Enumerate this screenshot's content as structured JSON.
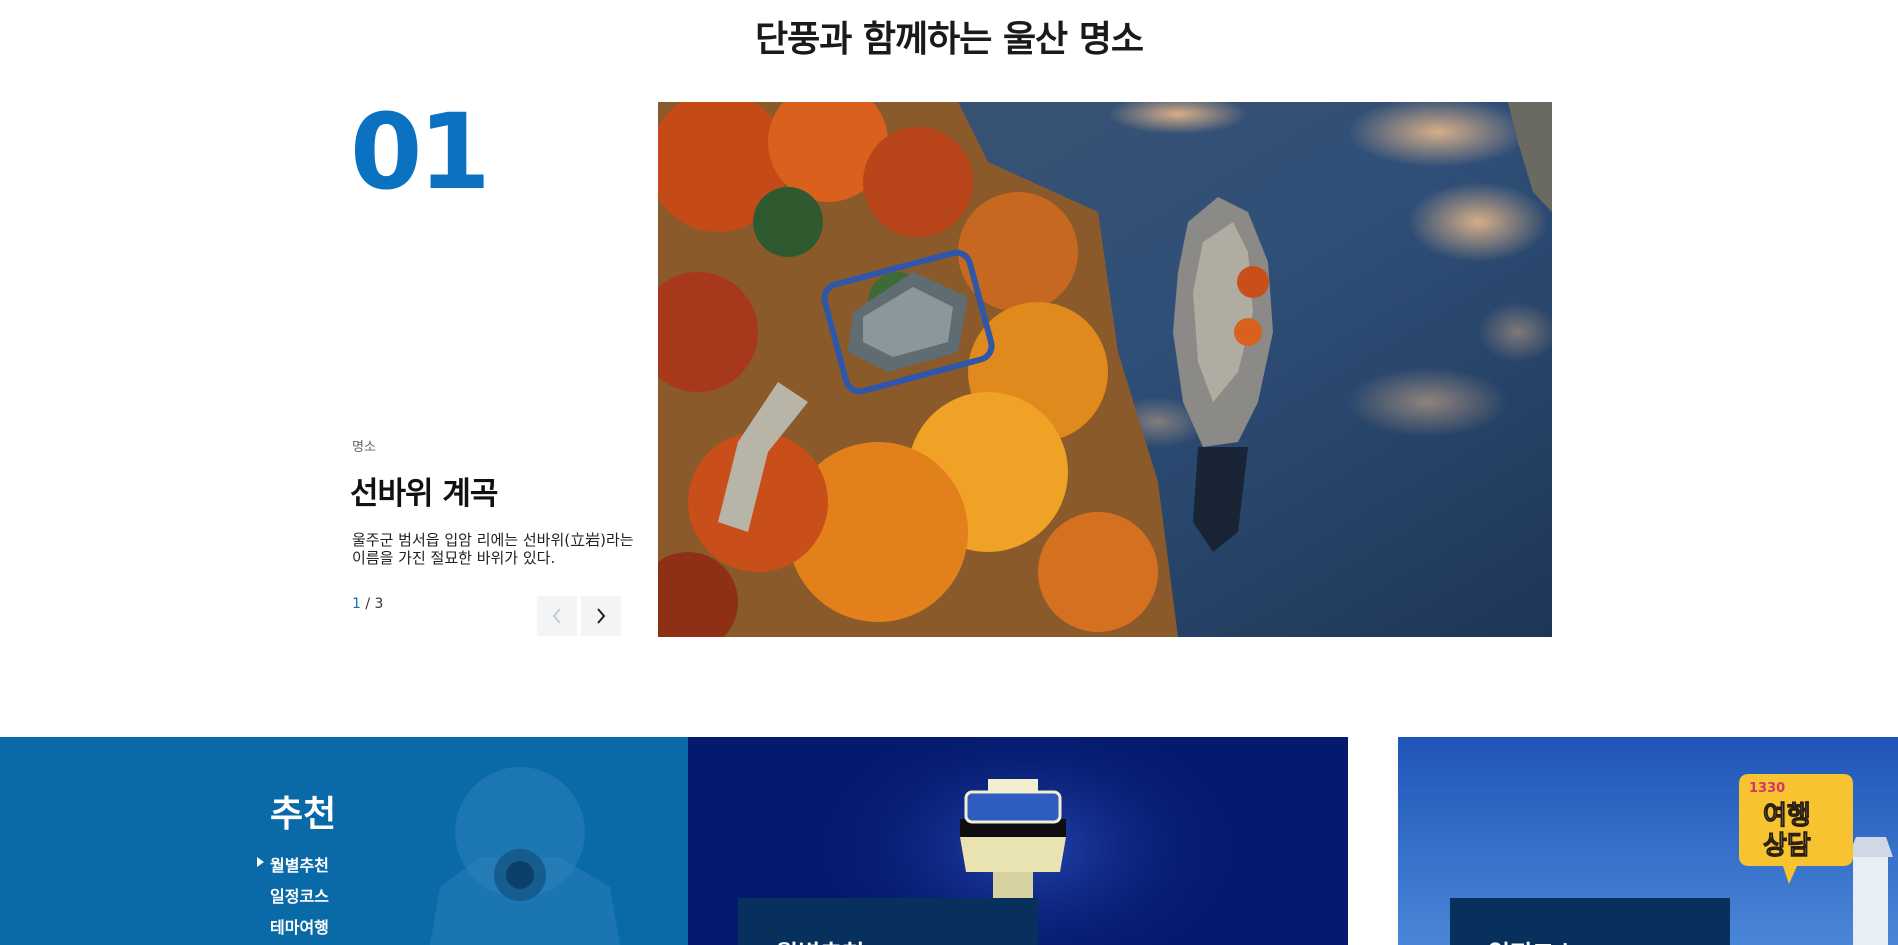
{
  "section": {
    "title": "단풍과 함께하는 울산 명소"
  },
  "slide": {
    "number": "01",
    "category": "명소",
    "name": "선바위 계곡",
    "description": "울주군 범서읍 입암 리에는 선바위(立岩)라는 이름을 가진 절묘한 바위가 있다.",
    "current": "1",
    "separator": " / ",
    "total": "3",
    "image_alt": "선바위 계곡 단풍 항공사진"
  },
  "recommend": {
    "title": "추천",
    "menu": [
      {
        "label": "월별추천",
        "active": true
      },
      {
        "label": "일정코스",
        "active": false
      },
      {
        "label": "테마여행",
        "active": false
      }
    ]
  },
  "cards": [
    {
      "label": "월별추천"
    },
    {
      "label": "일정코스"
    }
  ],
  "chat": {
    "line1": "1330",
    "line2": "여행",
    "line3": "상담"
  },
  "colors": {
    "accent": "#0b72c1",
    "panel": "#0a6aa7",
    "card_label": "#07305d"
  },
  "icons": {
    "prev": "chevron-left-icon",
    "next": "chevron-right-icon",
    "menu_active": "caret-right-icon"
  }
}
